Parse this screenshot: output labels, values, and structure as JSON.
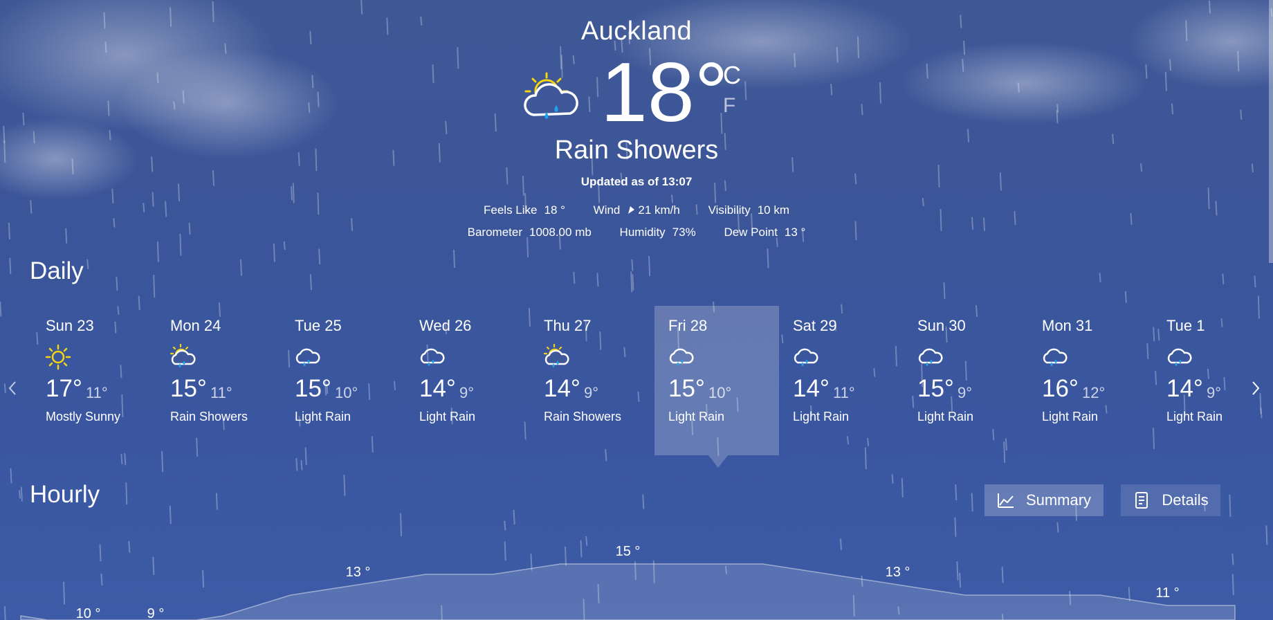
{
  "location": {
    "city": "Auckland"
  },
  "current": {
    "icon": "sun-cloud-rain-icon",
    "temperature": "18",
    "degree": "°",
    "unit_c": "C",
    "unit_f": "F",
    "condition": "Rain Showers",
    "updated": "Updated as of 13:07",
    "feels_like_label": "Feels Like",
    "feels_like_value": "18 °",
    "wind_label": "Wind",
    "wind_value": "21 km/h",
    "visibility_label": "Visibility",
    "visibility_value": "10 km",
    "barometer_label": "Barometer",
    "barometer_value": "1008.00 mb",
    "humidity_label": "Humidity",
    "humidity_value": "73%",
    "dewpoint_label": "Dew Point",
    "dewpoint_value": "13 °"
  },
  "daily": {
    "title": "Daily",
    "selected_index": 5,
    "days": [
      {
        "name": "Sun 23",
        "icon": "sun-icon",
        "hi": "17°",
        "lo": "11°",
        "condition": "Mostly Sunny"
      },
      {
        "name": "Mon 24",
        "icon": "sun-cloud-rain-icon",
        "hi": "15°",
        "lo": "11°",
        "condition": "Rain Showers"
      },
      {
        "name": "Tue 25",
        "icon": "cloud-rain-icon",
        "hi": "15°",
        "lo": "10°",
        "condition": "Light Rain"
      },
      {
        "name": "Wed 26",
        "icon": "cloud-rain-icon",
        "hi": "14°",
        "lo": "9°",
        "condition": "Light Rain"
      },
      {
        "name": "Thu 27",
        "icon": "sun-cloud-rain-icon",
        "hi": "14°",
        "lo": "9°",
        "condition": "Rain Showers"
      },
      {
        "name": "Fri 28",
        "icon": "cloud-rain-icon",
        "hi": "15°",
        "lo": "10°",
        "condition": "Light Rain"
      },
      {
        "name": "Sat 29",
        "icon": "cloud-rain-icon",
        "hi": "14°",
        "lo": "11°",
        "condition": "Light Rain"
      },
      {
        "name": "Sun 30",
        "icon": "cloud-rain-icon",
        "hi": "15°",
        "lo": "9°",
        "condition": "Light Rain"
      },
      {
        "name": "Mon 31",
        "icon": "cloud-rain-icon",
        "hi": "16°",
        "lo": "12°",
        "condition": "Light Rain"
      },
      {
        "name": "Tue 1",
        "icon": "cloud-rain-icon",
        "hi": "14°",
        "lo": "9°",
        "condition": "Light Rain"
      }
    ]
  },
  "hourly": {
    "title": "Hourly",
    "summary_label": "Summary",
    "details_label": "Details"
  },
  "chart_data": {
    "type": "area",
    "title": "",
    "unit": "°",
    "values": [
      10,
      9,
      9,
      10,
      12,
      13,
      14,
      14,
      15,
      15,
      15,
      15,
      14,
      13,
      12,
      12,
      12,
      11,
      11
    ],
    "labels": [
      {
        "index": 1,
        "text": "10 °"
      },
      {
        "index": 2,
        "text": "9 °"
      },
      {
        "index": 5,
        "text": "13 °"
      },
      {
        "index": 9,
        "text": "15 °"
      },
      {
        "index": 13,
        "text": "13 °"
      },
      {
        "index": 17,
        "text": "11 °"
      }
    ]
  },
  "colors": {
    "sun": "#f5d60c",
    "rain": "#1aa6ef",
    "selected_bg": "rgba(255,255,255,0.22)"
  }
}
